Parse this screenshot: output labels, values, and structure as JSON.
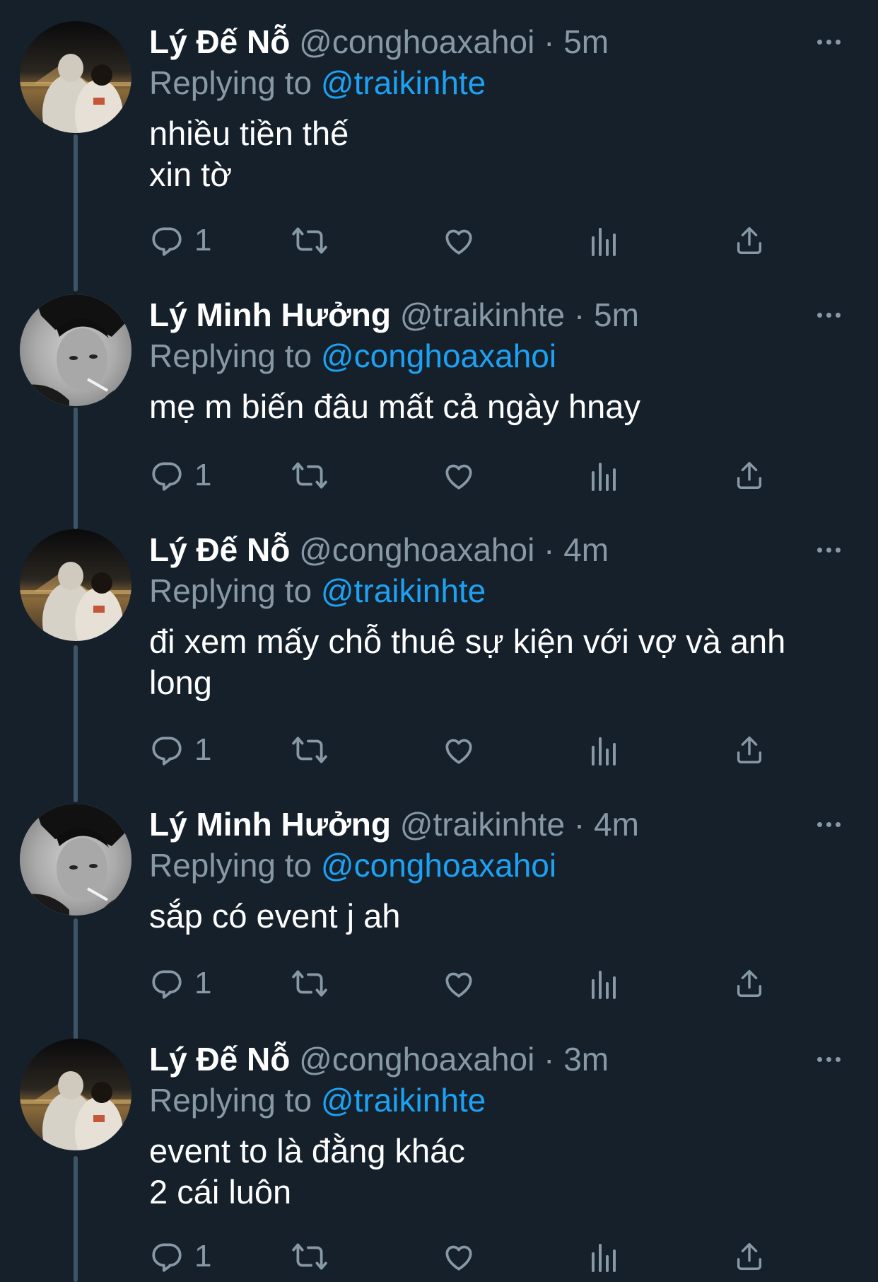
{
  "colors": {
    "background": "#15202b",
    "secondary_text": "#8899a6",
    "mention": "#1da1f2",
    "thread_line": "#3d5466"
  },
  "tweets": [
    {
      "name": "Lý Đế Nỗ",
      "handle": "@conghoaxahoi",
      "dot": "·",
      "time": "5m",
      "replying_prefix": "Replying to",
      "replying_to": "@traikinhte",
      "text": "nhiều tiền thế\nxin tờ",
      "reply_count": "1",
      "avatar": "avatar-night-photo"
    },
    {
      "name": "Lý Minh Hưởng",
      "handle": "@traikinhte",
      "dot": "·",
      "time": "5m",
      "replying_prefix": "Replying to",
      "replying_to": "@conghoaxahoi",
      "text": "mẹ m biến đâu mất cả ngày hnay",
      "reply_count": "1",
      "avatar": "avatar-bw-portrait"
    },
    {
      "name": "Lý Đế Nỗ",
      "handle": "@conghoaxahoi",
      "dot": "·",
      "time": "4m",
      "replying_prefix": "Replying to",
      "replying_to": "@traikinhte",
      "text": "đi xem mấy chỗ thuê sự kiện với vợ và anh\nlong",
      "reply_count": "1",
      "avatar": "avatar-night-photo"
    },
    {
      "name": "Lý Minh Hưởng",
      "handle": "@traikinhte",
      "dot": "·",
      "time": "4m",
      "replying_prefix": "Replying to",
      "replying_to": "@conghoaxahoi",
      "text": "sắp có event j ah",
      "reply_count": "1",
      "avatar": "avatar-bw-portrait"
    },
    {
      "name": "Lý Đế Nỗ",
      "handle": "@conghoaxahoi",
      "dot": "·",
      "time": "3m",
      "replying_prefix": "Replying to",
      "replying_to": "@traikinhte",
      "text": "event to là đằng khác\n2 cái luôn",
      "reply_count": "1",
      "avatar": "avatar-night-photo"
    }
  ],
  "action_icons": [
    "reply-icon",
    "retweet-icon",
    "like-icon",
    "analytics-icon",
    "share-icon"
  ]
}
